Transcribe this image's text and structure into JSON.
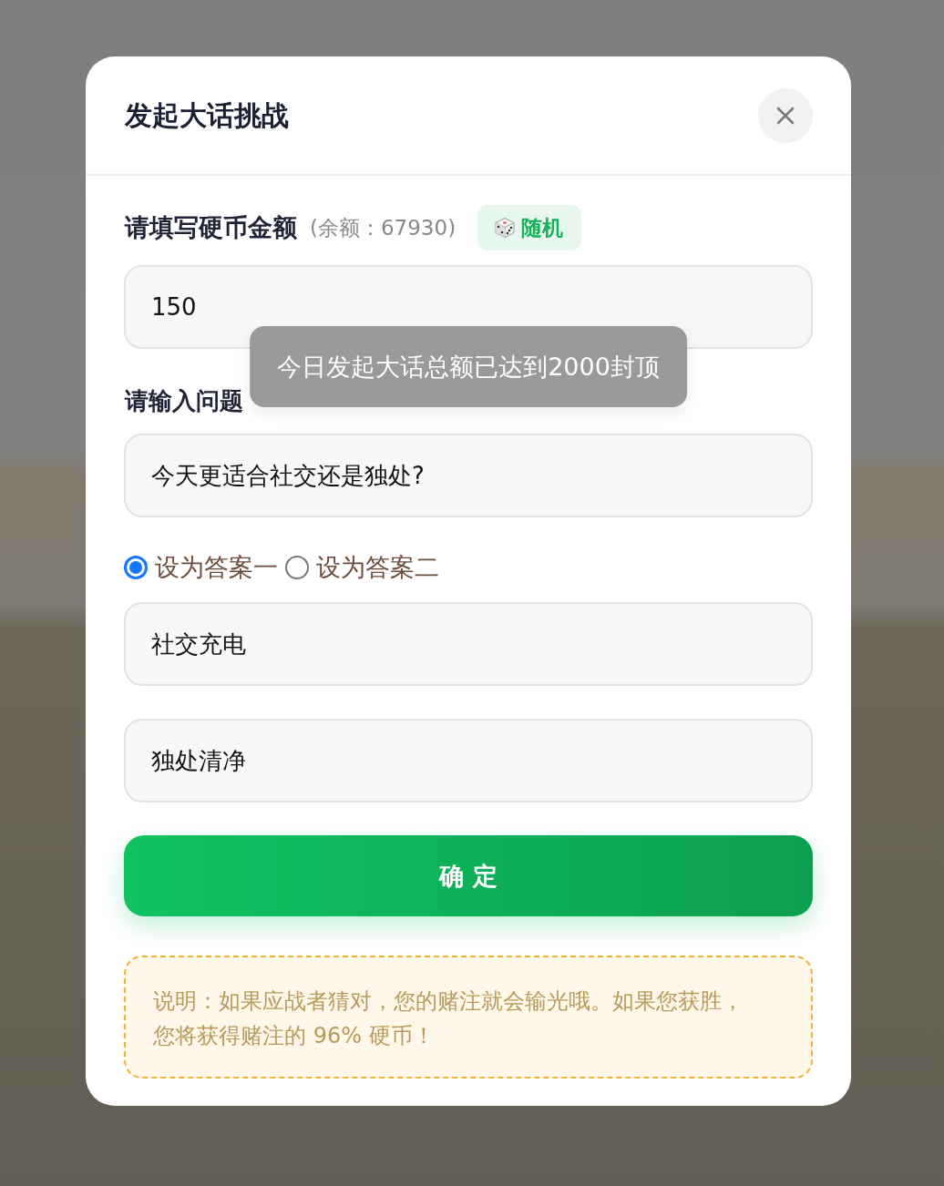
{
  "dialog": {
    "title": "发起大话挑战"
  },
  "amount": {
    "label": "请填写硬币金额",
    "balance": "(余额：67930)",
    "random_button": {
      "label": "随机"
    },
    "value": "150"
  },
  "toast": {
    "message": "今日发起大话总额已达到2000封顶"
  },
  "question": {
    "label": "请输入问题",
    "value": "今天更适合社交还是独处?"
  },
  "answer_options": [
    {
      "label": "设为答案一",
      "selected": true
    },
    {
      "label": "设为答案二",
      "selected": false
    }
  ],
  "answers": [
    {
      "value": "社交充电"
    },
    {
      "value": "独处清净"
    }
  ],
  "confirm_button": {
    "label": "确 定"
  },
  "note": {
    "text": "说明：如果应战者猜对，您的赌注就会输光哦。如果您获胜，您将获得赌注的 96% 硬币！"
  }
}
